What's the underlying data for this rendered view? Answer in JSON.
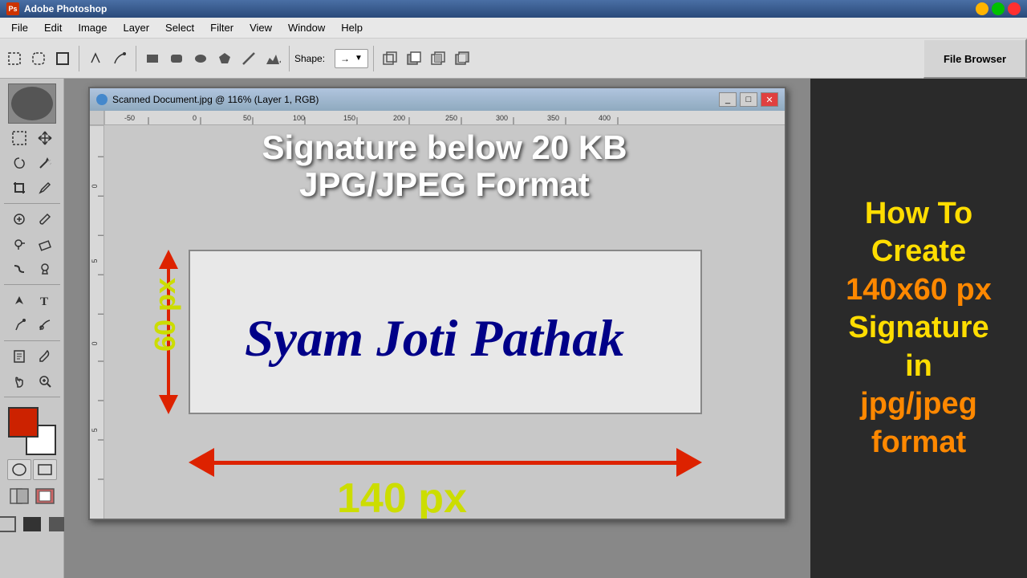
{
  "app": {
    "title": "Adobe Photoshop",
    "icon_label": "PS"
  },
  "menu": {
    "items": [
      "File",
      "Edit",
      "Image",
      "Layer",
      "Select",
      "Filter",
      "View",
      "Window",
      "Help"
    ]
  },
  "toolbar": {
    "shape_label": "Shape:",
    "shape_value": "→",
    "file_browser_label": "File Browser"
  },
  "document": {
    "title": "Scanned Document.jpg @ 116% (Layer 1, RGB)",
    "main_title_line1": "Signature below 20 KB",
    "main_title_line2": "JPG/JPEG Format",
    "signature_text": "Syam Joti Pathak",
    "label_60px": "60 px",
    "label_140px": "140 px"
  },
  "right_panel": {
    "line1": "How To",
    "line2": "Create",
    "line3": "140x60 px",
    "line4": "Signature",
    "line5": "in",
    "line6": "jpg/jpeg",
    "line7": "format"
  }
}
